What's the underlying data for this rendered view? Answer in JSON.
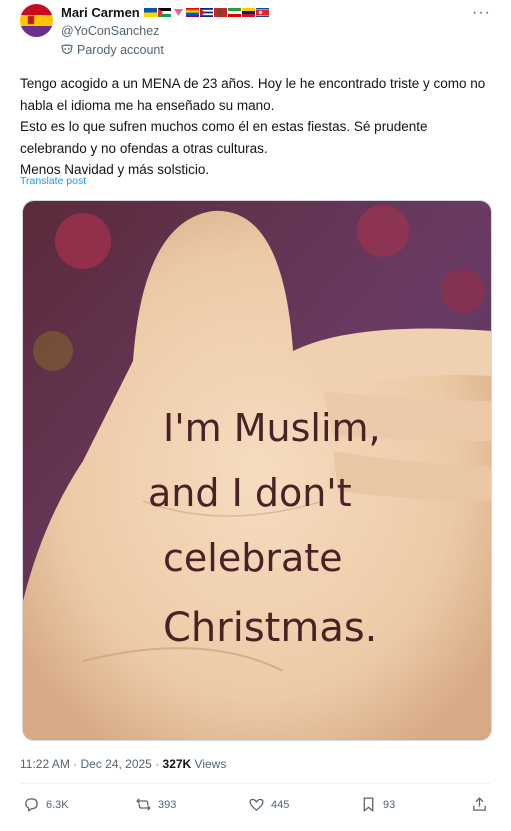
{
  "author": {
    "name": "Mari Carmen",
    "handle": "@YoConSanchez",
    "label": "Parody account",
    "flags": [
      "ukraine-flag",
      "palestine-flag",
      "pink-triangle",
      "lgbt-flag",
      "cuba-flag",
      "morocco-flag",
      "iran-flag",
      "venezuela-flag",
      "north-korea-flag"
    ]
  },
  "post": {
    "text": "Tengo acogido a un MENA de 23 años. Hoy le he encontrado triste y como no habla el idioma me ha enseñado su mano.\nEsto es lo que sufren muchos como él en estas fiestas.  Sé prudente celebrando y no ofendas a otras culturas.\nMenos Navidad y más solsticio.",
    "translate": "Translate post",
    "image_text": [
      "I'm Muslim,",
      "and I don't",
      "celebrate",
      "Christmas."
    ]
  },
  "meta": {
    "time": "11:22 AM · Dec 24, 2025 · ",
    "views_count": "327K",
    "views_label": " Views"
  },
  "actions": {
    "replies": "6.3K",
    "reposts": "393",
    "likes": "445",
    "bookmarks": "93"
  },
  "colors": {
    "link": "#1d9bf0",
    "muted": "#536471"
  }
}
